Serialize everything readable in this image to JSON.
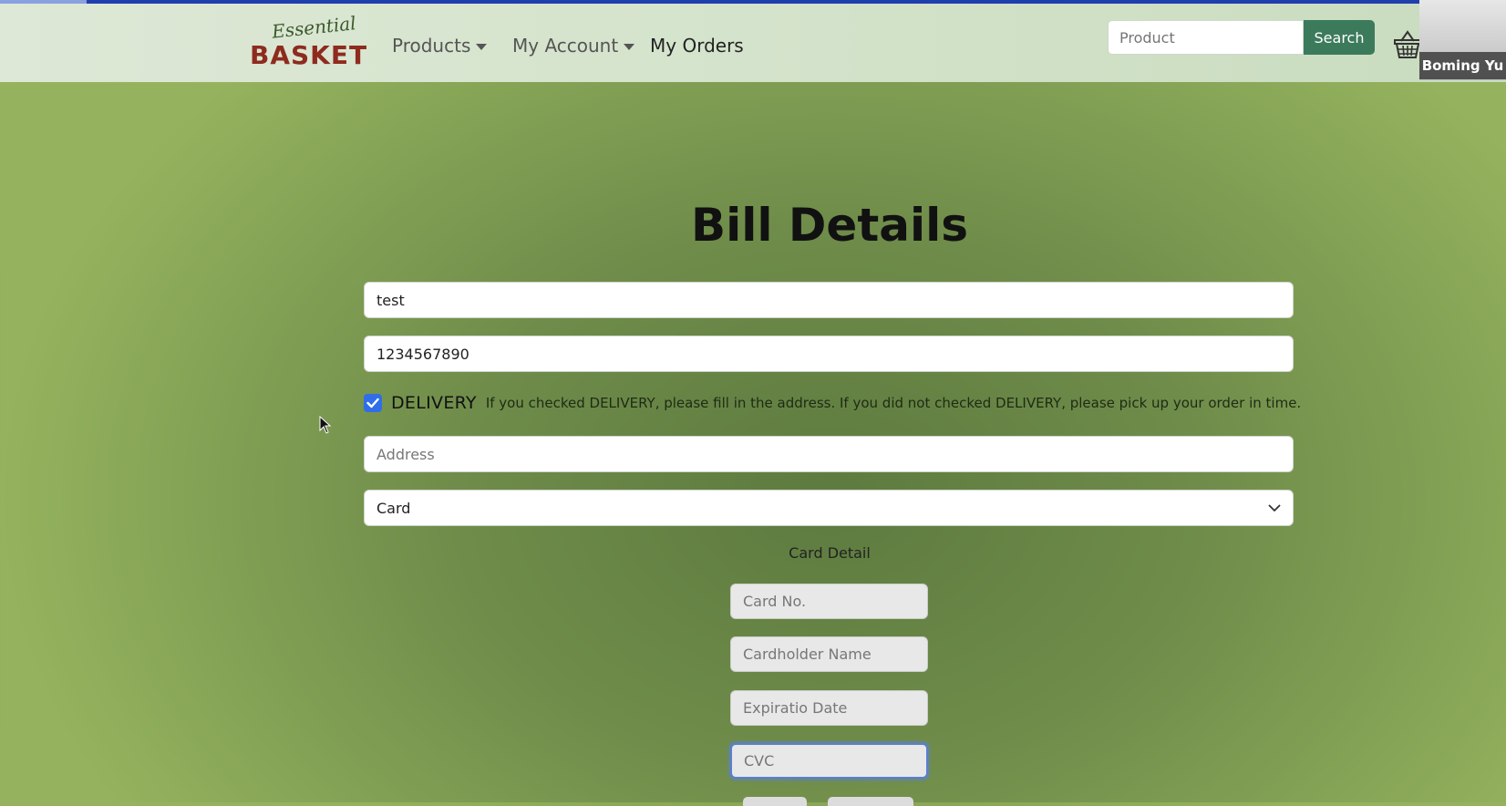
{
  "header": {
    "logo_script": "Essential",
    "logo_brand": "BASKET",
    "nav": {
      "products": "Products",
      "my_account": "My Account",
      "my_orders": "My Orders"
    },
    "search": {
      "placeholder": "Product",
      "value": "",
      "button": "Search"
    },
    "cart_icon": "basket-icon",
    "video_participant": "Boming Yu"
  },
  "form": {
    "title": "Bill Details",
    "name_value": "test",
    "phone_value": "1234567890",
    "delivery": {
      "checked": true,
      "label": "DELIVERY",
      "note": "If you checked DELIVERY, please fill in the address. If you did not checked DELIVERY, please pick up your order in time."
    },
    "address_placeholder": "Address",
    "payment_selected": "Card",
    "card_detail_label": "Card Detail",
    "card_no_placeholder": "Card No.",
    "cardholder_placeholder": "Cardholder Name",
    "expiration_placeholder": "Expiratio Date",
    "cvc_placeholder": "CVC"
  },
  "colors": {
    "accent": "#3c7a5c",
    "checkbox": "#2f6ee8",
    "brand": "#8e2b1e"
  }
}
